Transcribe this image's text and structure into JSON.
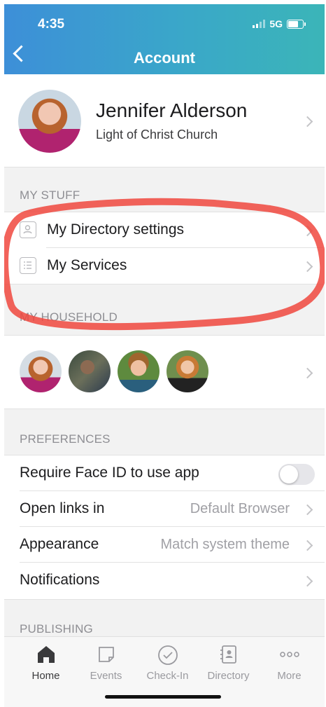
{
  "status": {
    "time": "4:35",
    "network": "5G"
  },
  "header": {
    "title": "Account"
  },
  "profile": {
    "name": "Jennifer Alderson",
    "church": "Light of Christ Church"
  },
  "my_stuff": {
    "label": "MY STUFF",
    "items": [
      {
        "label": "My Directory settings",
        "icon": "contact-card-icon"
      },
      {
        "label": "My Services",
        "icon": "list-icon"
      }
    ]
  },
  "household": {
    "label": "MY HOUSEHOLD",
    "member_count": 4
  },
  "preferences": {
    "label": "PREFERENCES",
    "face_id": {
      "label": "Require Face ID to use app",
      "enabled": false
    },
    "open_links": {
      "label": "Open links in",
      "value": "Default Browser"
    },
    "appearance": {
      "label": "Appearance",
      "value": "Match system theme"
    },
    "notifications": {
      "label": "Notifications"
    }
  },
  "publishing": {
    "label": "PUBLISHING"
  },
  "tabs": [
    {
      "label": "Home",
      "icon": "home-icon",
      "active": true
    },
    {
      "label": "Events",
      "icon": "events-icon",
      "active": false
    },
    {
      "label": "Check-In",
      "icon": "check-in-icon",
      "active": false
    },
    {
      "label": "Directory",
      "icon": "directory-icon",
      "active": false
    },
    {
      "label": "More",
      "icon": "more-icon",
      "active": false
    }
  ],
  "colors": {
    "header_start": "#3d8fd8",
    "header_end": "#3bb5b8",
    "annotation": "#f0483e"
  }
}
